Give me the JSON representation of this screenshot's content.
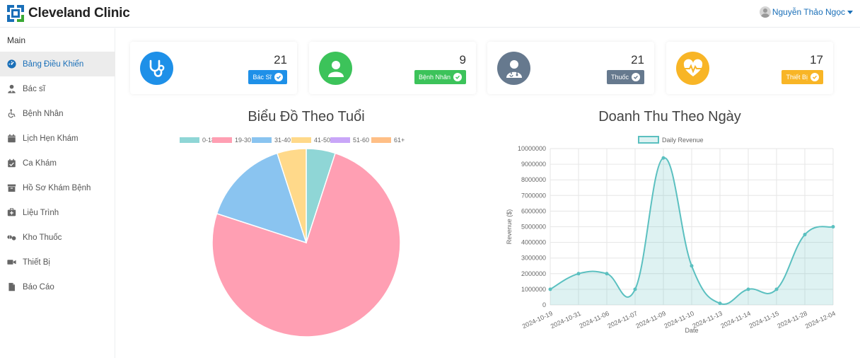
{
  "app": {
    "brand": "Cleveland Clinic",
    "user_name": "Nguyễn Thảo Ngọc",
    "colors": {
      "brand_blue": "#1a6fb8",
      "brand_green": "#3aa935"
    }
  },
  "sidebar": {
    "heading": "Main",
    "items": [
      {
        "label": "Bảng Điều Khiển",
        "icon": "dashboard-icon",
        "active": true
      },
      {
        "label": "Bác sĩ",
        "icon": "doctor-icon"
      },
      {
        "label": "Bệnh Nhân",
        "icon": "wheelchair-icon"
      },
      {
        "label": "Lịch Hẹn Khám",
        "icon": "calendar-icon"
      },
      {
        "label": "Ca Khám",
        "icon": "calendar-check-icon"
      },
      {
        "label": "Hồ Sơ Khám Bệnh",
        "icon": "archive-icon"
      },
      {
        "label": "Liệu Trình",
        "icon": "clinic-icon"
      },
      {
        "label": "Kho Thuốc",
        "icon": "pills-icon"
      },
      {
        "label": "Thiết Bị",
        "icon": "video-icon"
      },
      {
        "label": "Báo Cáo",
        "icon": "file-icon"
      }
    ]
  },
  "stats": [
    {
      "value": "21",
      "label": "Bác Sĩ",
      "icon": "stethoscope-icon",
      "color": "#1e90e8"
    },
    {
      "value": "9",
      "label": "Bệnh Nhân",
      "icon": "user-icon",
      "color": "#3cc35a"
    },
    {
      "value": "21",
      "label": "Thuốc",
      "icon": "doctor-user-icon",
      "color": "#66798e"
    },
    {
      "value": "17",
      "label": "Thiết Bị",
      "icon": "heartbeat-icon",
      "color": "#f8b526"
    }
  ],
  "chart_data": [
    {
      "type": "pie",
      "title": "Biểu Đồ Theo Tuổi",
      "legend_position": "top",
      "categories": [
        "0-18",
        "19-30",
        "31-40",
        "41-50",
        "51-60",
        "61+"
      ],
      "values": [
        1,
        15,
        3,
        1,
        0,
        0
      ],
      "colors": [
        "#8fd6d6",
        "#ff9fb3",
        "#8ac4f0",
        "#ffd98a",
        "#c9a6f8",
        "#ffbf86"
      ]
    },
    {
      "type": "line",
      "title": "Doanh Thu Theo Ngày",
      "legend_position": "top",
      "series": [
        {
          "name": "Daily Revenue",
          "color": "#5bc0c0",
          "fill": "rgba(91,192,192,0.2)"
        }
      ],
      "x": [
        "2024-10-19",
        "2024-10-31",
        "2024-11-06",
        "2024-11-07",
        "2024-11-09",
        "2024-11-10",
        "2024-11-13",
        "2024-11-14",
        "2024-11-15",
        "2024-11-28",
        "2024-12-04"
      ],
      "values": [
        1000000,
        2000000,
        2000000,
        1000000,
        9400000,
        2500000,
        100000,
        1000000,
        1000000,
        4500000,
        5000000
      ],
      "xlabel": "Date",
      "ylabel": "Revenue ($)",
      "ylim": [
        0,
        10000000
      ],
      "yticks": [
        "10000000",
        "9000000",
        "8000000",
        "7000000",
        "6000000",
        "5000000",
        "4000000",
        "3000000",
        "2000000",
        "1000000",
        "0"
      ],
      "grid": true
    }
  ]
}
